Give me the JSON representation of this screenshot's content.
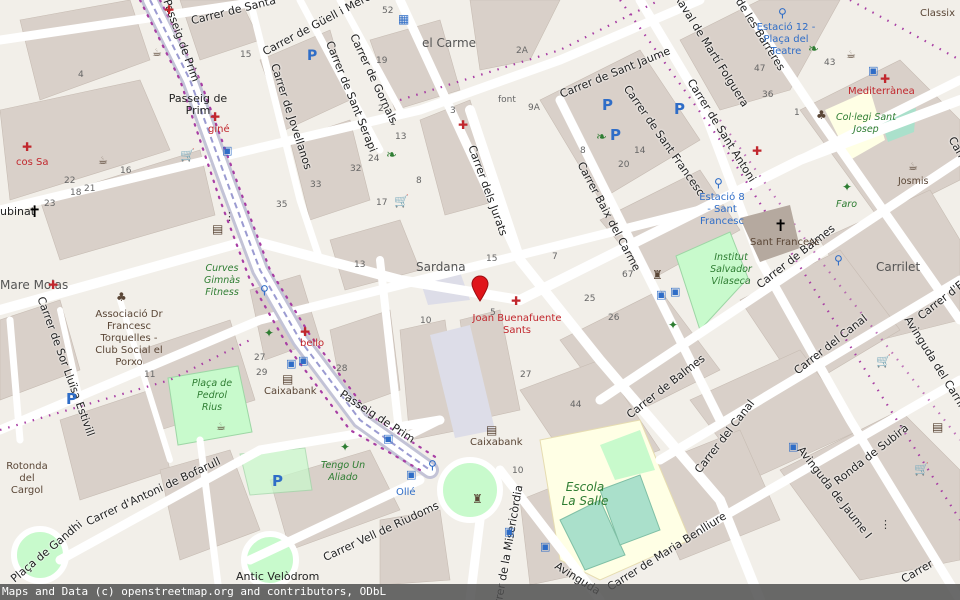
{
  "map": {
    "pin_color": "#e0151b",
    "colors": {
      "background": "#f2efe9",
      "building": "#d9d0c9",
      "road": "#ffffff",
      "pedestrian": "#dddde8",
      "park": "#c8facc",
      "pitch": "#aae0cb",
      "school": "#ffffe5",
      "primary_road": "#fcd6a4",
      "rail_dots": "#a83ea4"
    },
    "streets": [
      "Carrer de Santa",
      "Carrer de Güell i Mercader",
      "Passeig de Prim",
      "Carrer de Jovellanos",
      "Carrer de Sant Serapi",
      "Carrer de Gornals",
      "Carrer de Sant Jaume",
      "Raval de Martí Folguera",
      "Carrer de les Barreres",
      "Carrer de Sant Antoni",
      "Carrer de Sant Francesc",
      "Carrer Baix del Carme",
      "Carrer dels Jurats",
      "Carrer de Balmes",
      "Carrer de Balmes",
      "Carrer del Canal",
      "Carrer del Canal",
      "Avinguda del Carrilet",
      "Carrer d'Eduard",
      "Avinguda de Jaume I",
      "Ronda de Subirà",
      "Carrer de Maria Benlliure",
      "Carrer de la Misericòrdia",
      "Avinguda",
      "Carrer Vell de Riudoms",
      "Carrer d'Antoni de Bofarull",
      "Passeig de Prim",
      "Plaça de Gandhi",
      "Carrer de Sor Lluïsa Estivill",
      "Carrer de Closa",
      "Carrer"
    ],
    "places": {
      "el_carme": "el Carme",
      "sardana": "Sardana",
      "mare_molas": "Mare Molas",
      "carrilet": "Carrilet",
      "antic_velodrom": "Antic Velòdrom",
      "passeig_de_prim": "Passeig de Prim",
      "subinat": "ubinat",
      "font": "font"
    },
    "pois": {
      "joan_buenafuente": "Joan Buenafuente Sants",
      "gine": "giné",
      "cos_sa": "cos Sa",
      "bello": "bello",
      "mediterranea": "Mediterrànea",
      "estacio12": "Estació 12 - Plaça del Teatre",
      "estacio8": "Estació 8 - Sant Francesc",
      "sant_francesc": "Sant Francesc",
      "institut": "Institut Salvador Vilaseca",
      "col_legi": "Col·legi Sant Josep",
      "josmis": "Josmis",
      "faro": "Faro",
      "curves": "Curves Gimnàs Fitness",
      "associacio": "Associació Dr Francesc Torquelles - Club Social el Porxo",
      "placa_pedrol": "Plaça de Pedrol Rius",
      "caixabank1": "Caixabank",
      "caixabank2": "Caixabank",
      "tengo_un_aliado": "Tengo Un Aliado",
      "olle": "Ollé",
      "rotonda": "Rotonda del Cargol",
      "escola": "Escola La Salle",
      "classix": "Classix"
    },
    "house_numbers": [
      "52",
      "15",
      "4",
      "2A",
      "2",
      "1",
      "19",
      "17",
      "13",
      "8",
      "33",
      "35",
      "24",
      "32",
      "15",
      "13",
      "9A",
      "20",
      "14",
      "8",
      "7",
      "67",
      "25",
      "26",
      "27",
      "44",
      "10",
      "11",
      "29",
      "28",
      "27",
      "18",
      "23",
      "22",
      "21",
      "16",
      "10",
      "5",
      "3",
      "1",
      "47",
      "43",
      "36",
      "32",
      "29"
    ]
  },
  "attribution": "Maps and Data (c) openstreetmap.org and contributors, ODbL"
}
